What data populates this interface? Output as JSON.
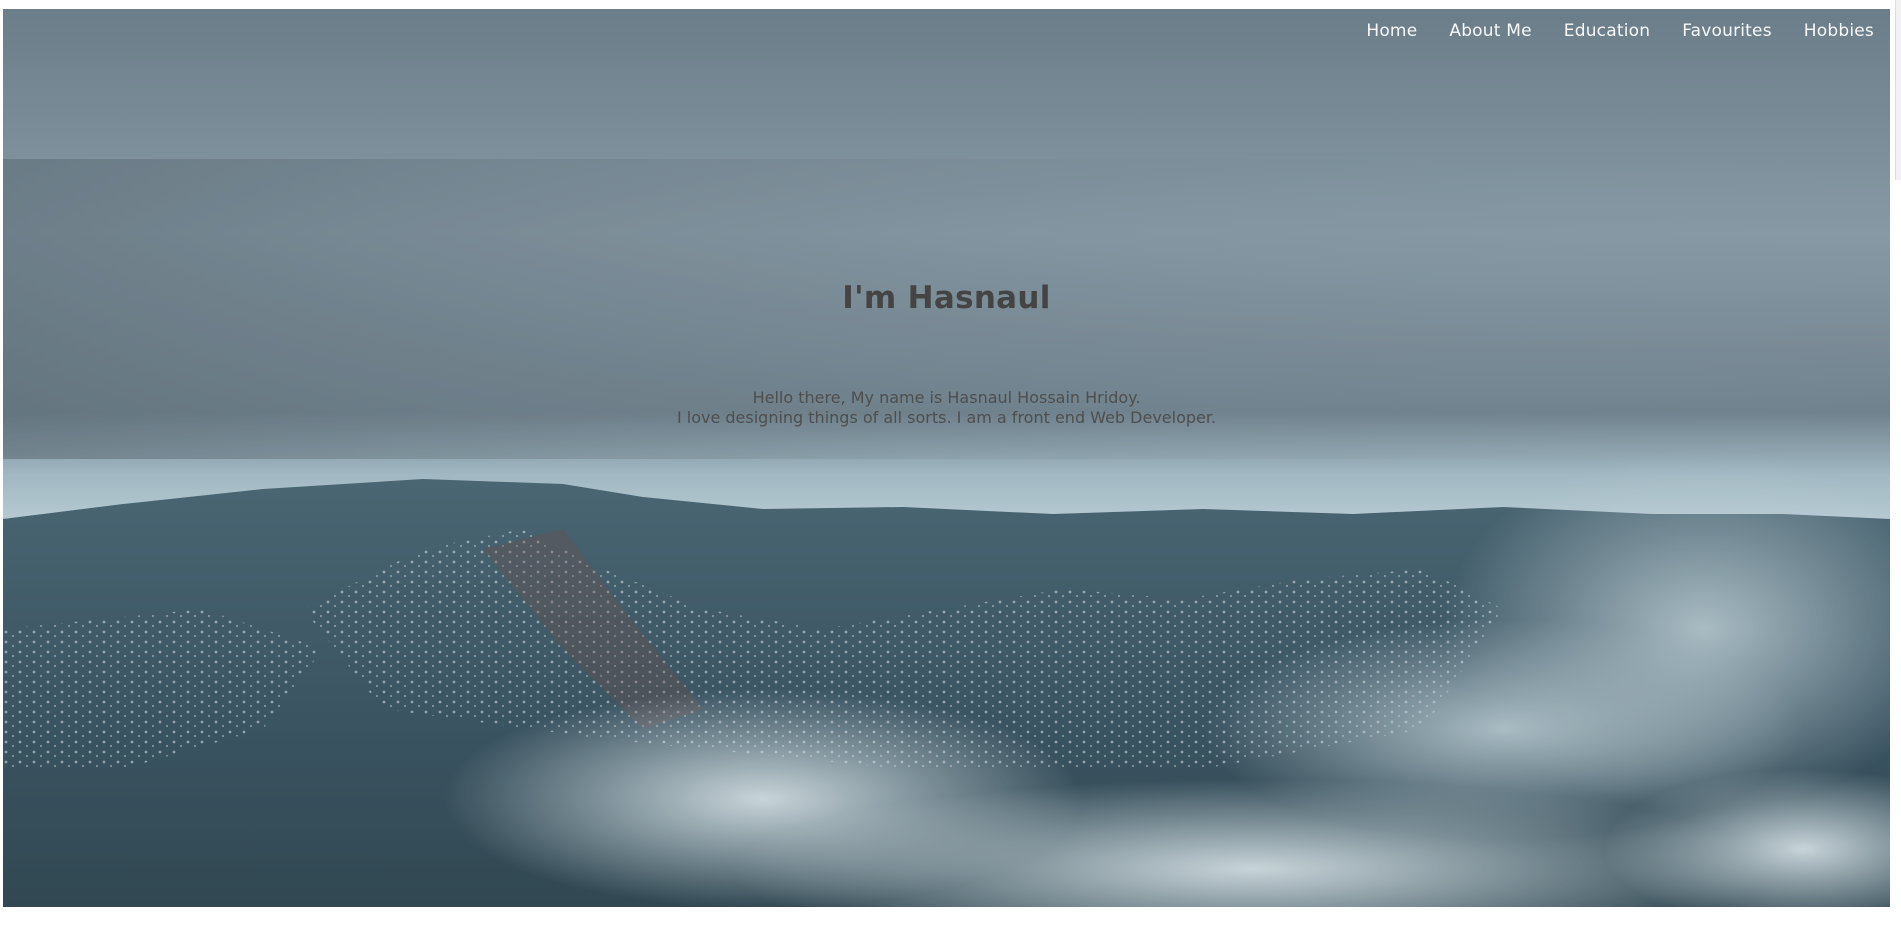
{
  "nav": {
    "items": [
      {
        "label": "Home",
        "name": "nav-link-home"
      },
      {
        "label": "About Me",
        "name": "nav-link-about-me"
      },
      {
        "label": "Education",
        "name": "nav-link-education"
      },
      {
        "label": "Favourites",
        "name": "nav-link-favourites"
      },
      {
        "label": "Hobbies",
        "name": "nav-link-hobbies"
      }
    ]
  },
  "hero": {
    "title": "I'm Hasnaul",
    "intro_line_1": "Hello there, My name is Hasnaul Hossain Hridoy.",
    "intro_line_2": "I love designing things of all sorts. I am a front end Web Developer."
  },
  "colors": {
    "nav_text": "#ffffff",
    "title_text": "#444444",
    "intro_text": "#4e4e4e",
    "sky_top": "#7d8f9a",
    "mountain": "#3b5562"
  }
}
